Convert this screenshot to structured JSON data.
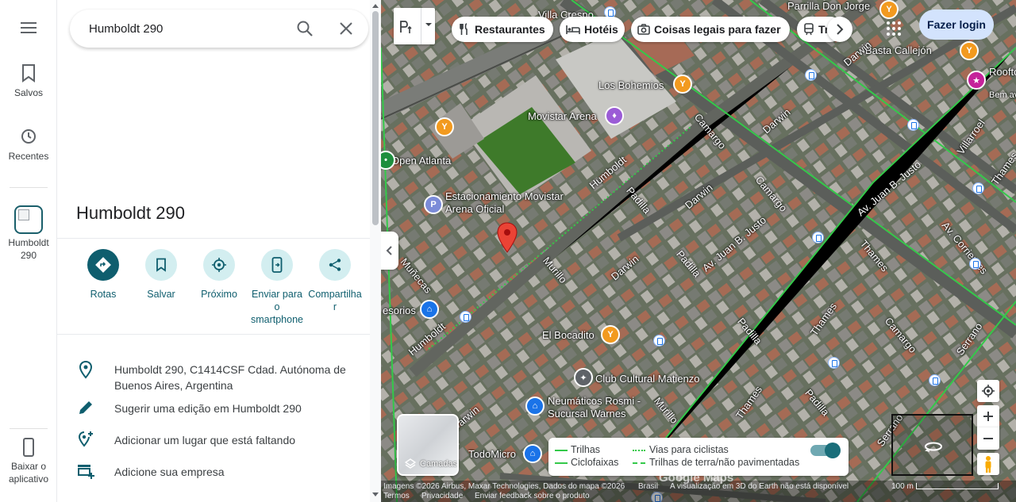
{
  "rail": {
    "menu_icon": "menu-icon",
    "saved_label": "Salvos",
    "recent_label": "Recentes",
    "thumb_label": "Humboldt 290",
    "download_label": "Baixar o aplicativo"
  },
  "search": {
    "value": "Humboldt 290"
  },
  "place": {
    "title": "Humboldt 290",
    "actions": [
      {
        "label": "Rotas",
        "icon": "directions-icon"
      },
      {
        "label": "Salvar",
        "icon": "bookmark-icon"
      },
      {
        "label": "Próximo",
        "icon": "nearby-icon"
      },
      {
        "label": "Enviar para o smartphone",
        "icon": "send-to-phone-icon"
      },
      {
        "label": "Compartilhar",
        "icon": "share-icon"
      }
    ],
    "info": [
      {
        "text": "Humboldt 290, C1414CSF Cdad. Autónoma de Buenos Aires, Argentina",
        "icon": "location-pin-icon"
      },
      {
        "text": "Sugerir uma edição em Humboldt 290",
        "icon": "pencil-icon"
      },
      {
        "text": "Adicionar um lugar que está faltando",
        "icon": "add-place-icon"
      },
      {
        "text": "Adicione sua empresa",
        "icon": "add-business-icon"
      }
    ]
  },
  "map": {
    "chips": [
      {
        "label": "Restaurantes",
        "icon": "restaurant-icon"
      },
      {
        "label": "Hotéis",
        "icon": "hotel-icon"
      },
      {
        "label": "Coisas legais para fazer",
        "icon": "camera-icon"
      },
      {
        "label": "Tr",
        "icon": "transit-icon"
      }
    ],
    "login_label": "Fazer login",
    "labels": {
      "villa_crespo": "Villa Crespo",
      "parrilla": "Parrilla Don Jorge",
      "basta": "Basta Callejón",
      "rooftop": "Roofto Movis",
      "bem_av": "Bem av",
      "los_bohemios": "Los Bohemios",
      "movistar_arena": "Movistar Arena",
      "open_atlanta": "Open Atlanta",
      "estacionamiento": "Estacionamiento Movistar Arena Oficial",
      "el_bocadito": "El Bocadito",
      "club_cultural": "Club Cultural Matienzo",
      "neumaticos": "Neumáticos Rosmi - Sucursal Warnes",
      "todomicro": "TodoMicro",
      "accesorios": "esorios",
      "darwin": "Darwin",
      "camargo": "Camargo",
      "humboldt": "Humboldt",
      "padilla": "Padilla",
      "murillo": "Murillo",
      "av_juan_b_justo": "Av. Juan B. Justo",
      "av_corrientes": "Av. Corrientes",
      "villarroel": "Villarroel",
      "thames": "Thames",
      "serrano": "Serrano",
      "muniecas": "Muñecas"
    },
    "layers_label": "Camadas",
    "legend": {
      "trails": "Trilhas",
      "bike_lanes": "Ciclofaixas",
      "bike_roads": "Vias para ciclistas",
      "dirt_trails": "Trilhas de terra/não pavimentadas",
      "toggle_on": true
    },
    "footer": {
      "imagery": "Imagens ©2026 Airbus, Maxar Technologies, Dados do mapa ©2026",
      "brasil": "Brasil",
      "brand": "Google Maps",
      "notice": "A visualização em 3D do Earth não está disponível",
      "scale": "100 m",
      "terms": "Termos",
      "privacy": "Privacidade",
      "feedback": "Enviar feedback sobre o produto"
    },
    "colors": {
      "bike_green": "#34c94a",
      "pin_red": "#ea4335",
      "teal": "#0f5e6e"
    }
  }
}
